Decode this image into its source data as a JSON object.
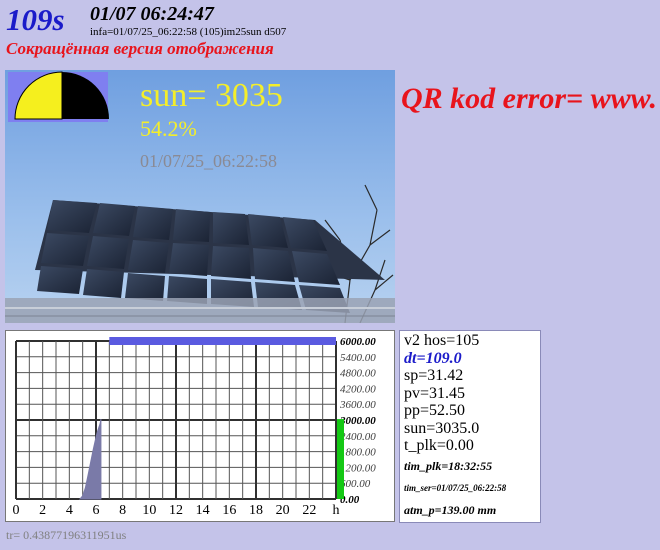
{
  "header": {
    "title_number": "109s",
    "datetime": "01/07 06:24:47",
    "info": "infa=01/07/25_06:22:58   (105)im25sun  d507",
    "version_text": "Сокращённая версия отображения"
  },
  "photo": {
    "sun_value": "sun= 3035",
    "sun_percent": "54.2%",
    "timestamp": "01/07/25_06:22:58",
    "indicator_fraction": 0.5,
    "indicator_colors": {
      "left": "#f5ef1e",
      "right": "#000000",
      "box": "#7f7ff0"
    }
  },
  "qr_error": "QR kod error=  www.",
  "chart_data": {
    "type": "area",
    "x_ticks": [
      "0",
      "2",
      "4",
      "6",
      "8",
      "10",
      "12",
      "14",
      "16",
      "18",
      "20",
      "22",
      "h"
    ],
    "y_ticks": [
      "6000.00",
      "5400.00",
      "4800.00",
      "4200.00",
      "3600.00",
      "3000.00",
      "2400.00",
      "1800.00",
      "1200.00",
      "600.00",
      "0.00"
    ],
    "bold_y_ticks": [
      "6000.00",
      "3000.00",
      "0.00"
    ],
    "xlim": [
      0,
      24
    ],
    "ylim": [
      0,
      6000
    ],
    "series": [
      {
        "color": "#7a7aa8",
        "x": [
          4.8,
          5.0,
          5.2,
          5.4,
          5.6,
          5.8,
          6.0,
          6.1,
          6.2,
          6.3,
          6.37
        ],
        "y": [
          0,
          120,
          420,
          900,
          1400,
          1900,
          2350,
          2550,
          2700,
          2850,
          3035
        ]
      }
    ],
    "top_bar_color": "#5a5ae0",
    "current_bar": {
      "value": 3035,
      "color": "#14c814"
    }
  },
  "status": {
    "hos": "v2 hos=105",
    "dt": "dt=109.0",
    "sp": "sp=31.42",
    "pv": "pv=31.45",
    "pp": "pp=52.50",
    "sun": "sun=3035.0",
    "t_plk": "t_plk=0.00",
    "tim_plk": "tim_plk=18:32:55",
    "tim_ser": "tim_ser=01/07/25_06:22:58",
    "atm_p": "atm_p=139.00 mm"
  },
  "footer": "tr= 0.43877196311951us"
}
